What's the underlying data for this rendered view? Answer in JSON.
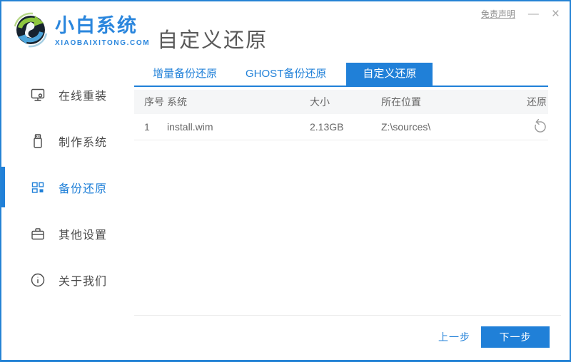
{
  "window": {
    "disclaimer_label": "免责声明",
    "minimize_glyph": "—",
    "close_glyph": "×"
  },
  "brand": {
    "name": "小白系统",
    "domain": "XIAOBAIXITONG.COM"
  },
  "page_title": "自定义还原",
  "sidebar": {
    "items": [
      {
        "label": "在线重装",
        "icon": "monitor-icon",
        "active": false
      },
      {
        "label": "制作系统",
        "icon": "usb-drive-icon",
        "active": false
      },
      {
        "label": "备份还原",
        "icon": "backup-grid-icon",
        "active": true
      },
      {
        "label": "其他设置",
        "icon": "toolbox-icon",
        "active": false
      },
      {
        "label": "关于我们",
        "icon": "info-icon",
        "active": false
      }
    ]
  },
  "tabs": [
    {
      "label": "增量备份还原",
      "active": false
    },
    {
      "label": "GHOST备份还原",
      "active": false
    },
    {
      "label": "自定义还原",
      "active": true
    }
  ],
  "table": {
    "headers": [
      "序号",
      "系统",
      "大小",
      "所在位置",
      "还原"
    ],
    "rows": [
      {
        "no": "1",
        "system": "install.wim",
        "size": "2.13GB",
        "location": "Z:\\sources\\",
        "restore_icon": "restore-icon"
      }
    ]
  },
  "footer": {
    "prev_label": "上一步",
    "next_label": "下一步"
  },
  "colors": {
    "accent": "#2080d8",
    "border": "#2583d5",
    "table_header_bg": "#f5f6f7",
    "text_gray": "#666666"
  }
}
